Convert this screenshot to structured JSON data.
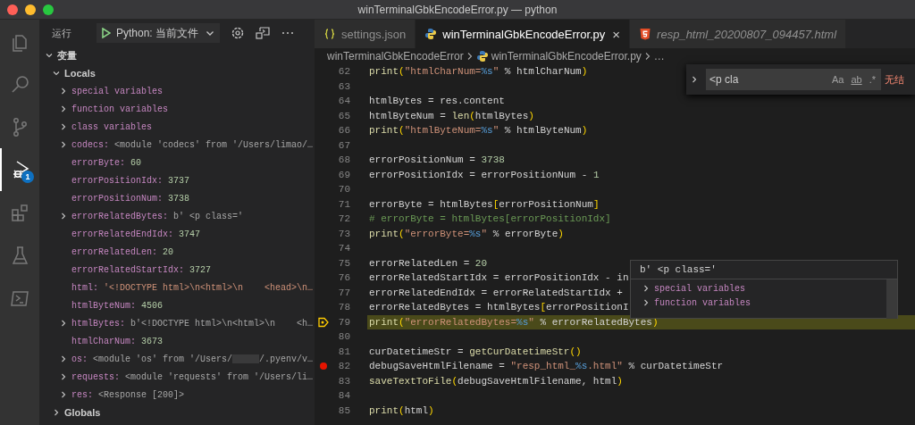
{
  "window": {
    "title": "winTerminalGbkEncodeError.py — python"
  },
  "activity_bar": {
    "items": [
      {
        "kind": "files",
        "selected": false
      },
      {
        "kind": "search",
        "selected": false
      },
      {
        "kind": "source-control",
        "selected": false
      },
      {
        "kind": "debug",
        "selected": true,
        "badge": "1"
      },
      {
        "kind": "extensions",
        "selected": false
      },
      {
        "kind": "testing",
        "selected": false
      },
      {
        "kind": "terminal",
        "selected": false
      }
    ]
  },
  "run_panel": {
    "title": "运行",
    "config": "Python: 当前文件"
  },
  "variables": {
    "title": "变量",
    "expanded": true,
    "scopes": [
      {
        "name": "Locals",
        "expanded": true,
        "children": [
          {
            "name": "special variables",
            "expanded": false
          },
          {
            "name": "function variables",
            "expanded": false
          },
          {
            "name": "class variables",
            "expanded": false
          },
          {
            "name": "codecs:",
            "value": "<module 'codecs' from '/Users/limao/…",
            "kind": "object",
            "expanded": false
          },
          {
            "name": "errorByte:",
            "value": "60",
            "kind": "number"
          },
          {
            "name": "errorPositionIdx:",
            "value": "3737",
            "kind": "number"
          },
          {
            "name": "errorPositionNum:",
            "value": "3738",
            "kind": "number"
          },
          {
            "name": "errorRelatedBytes:",
            "value": "b' <p class='",
            "kind": "object",
            "expanded": false
          },
          {
            "name": "errorRelatedEndIdx:",
            "value": "3747",
            "kind": "number"
          },
          {
            "name": "errorRelatedLen:",
            "value": "20",
            "kind": "number"
          },
          {
            "name": "errorRelatedStartIdx:",
            "value": "3727",
            "kind": "number"
          },
          {
            "name": "html:",
            "value": "'<!DOCTYPE html>\\n<html>\\n    <head>\\n…",
            "kind": "string"
          },
          {
            "name": "htmlByteNum:",
            "value": "4506",
            "kind": "number"
          },
          {
            "name": "htmlBytes:",
            "value": "b'<!DOCTYPE html>\\n<html>\\n    <h…",
            "kind": "object",
            "expanded": false
          },
          {
            "name": "htmlCharNum:",
            "value": "3673",
            "kind": "number"
          },
          {
            "name": "os:",
            "value": "<module 'os' from '/Users/",
            "redacted": true,
            "value_tail": "/.pyenv/v…",
            "kind": "object",
            "expanded": false
          },
          {
            "name": "requests:",
            "value": "<module 'requests' from '/Users/li…",
            "kind": "object",
            "expanded": false
          },
          {
            "name": "res:",
            "value": "<Response [200]>",
            "kind": "object",
            "expanded": false
          }
        ]
      },
      {
        "name": "Globals",
        "expanded": false
      }
    ]
  },
  "tabs": [
    {
      "label": "settings.json",
      "kind": "json",
      "selected": false,
      "preview": false
    },
    {
      "label": "winTerminalGbkEncodeError.py",
      "kind": "python",
      "selected": true,
      "preview": false,
      "close": "×"
    },
    {
      "label": "resp_html_20200807_094457.html",
      "kind": "html",
      "selected": false,
      "preview": true
    }
  ],
  "breadcrumb": {
    "items": [
      {
        "label": "winTerminalGbkEncodeError",
        "kind": "folder"
      },
      {
        "label": "winTerminalGbkEncodeError.py",
        "kind": "python"
      },
      {
        "label": "…",
        "kind": "symbol"
      }
    ]
  },
  "find_widget": {
    "value": "<p cla",
    "toggles": [
      "Aa",
      "ab",
      ".*"
    ],
    "status": "无结"
  },
  "code": {
    "lines": [
      {
        "num": "62",
        "kind": "plain",
        "text": "print(\"htmlCharNum=%s\" % htmlCharNum)"
      },
      {
        "num": "63",
        "kind": "plain"
      },
      {
        "num": "64",
        "kind": "plain",
        "text": "htmlBytes = res.content"
      },
      {
        "num": "65",
        "kind": "plain",
        "text": "htmlByteNum = len(htmlBytes)"
      },
      {
        "num": "66",
        "kind": "plain",
        "text": "print(\"htmlByteNum=%s\" % htmlByteNum)"
      },
      {
        "num": "67",
        "kind": "plain"
      },
      {
        "num": "68",
        "kind": "plain",
        "text": "errorPositionNum = 3738"
      },
      {
        "num": "69",
        "kind": "plain",
        "text": "errorPositionIdx = errorPositionNum - 1"
      },
      {
        "num": "70",
        "kind": "plain"
      },
      {
        "num": "71",
        "kind": "plain",
        "text": "errorByte = htmlBytes[errorPositionNum]"
      },
      {
        "num": "72",
        "kind": "plain",
        "text": "# errorByte = htmlBytes[errorPositionIdx]"
      },
      {
        "num": "73",
        "kind": "plain",
        "text": "print(\"errorByte=%s\" % errorByte)"
      },
      {
        "num": "74",
        "kind": "plain"
      },
      {
        "num": "75",
        "kind": "plain",
        "text": "errorRelatedLen = 20"
      },
      {
        "num": "76",
        "kind": "plain",
        "text": "errorRelatedStartIdx = errorPositionIdx - in"
      },
      {
        "num": "77",
        "kind": "plain",
        "text": "errorRelatedEndIdx = errorRelatedStartIdx +"
      },
      {
        "num": "78",
        "kind": "plain",
        "text": "errorRelatedBytes = htmlBytes[errorPositionI"
      },
      {
        "num": "79",
        "kind": "stopped",
        "text": "print(\"errorRelatedBytes=%s\" % errorRelatedBytes)"
      },
      {
        "num": "80",
        "kind": "plain"
      },
      {
        "num": "81",
        "kind": "plain",
        "text": "curDatetimeStr = getCurDatetimeStr()"
      },
      {
        "num": "82",
        "kind": "breakpoint",
        "text": "debugSaveHtmlFilename = \"resp_html_%s.html\" % curDatetimeStr"
      },
      {
        "num": "83",
        "kind": "plain",
        "text": "saveTextToFile(debugSaveHtmlFilename, html)"
      },
      {
        "num": "84",
        "kind": "plain"
      },
      {
        "num": "85",
        "kind": "plain",
        "text": "print(html)"
      }
    ]
  },
  "hover": {
    "title": "b' <p class='",
    "children": [
      {
        "name": "special variables",
        "expanded": false
      },
      {
        "name": "function variables",
        "expanded": false
      }
    ]
  }
}
